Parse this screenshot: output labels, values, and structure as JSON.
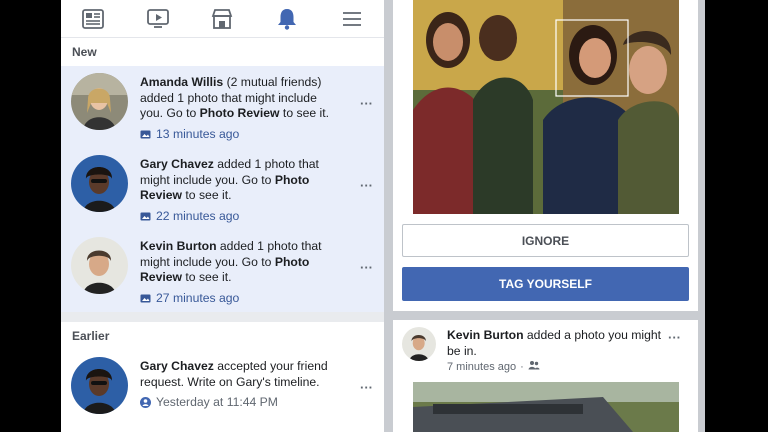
{
  "nav": {
    "icons": [
      "news-feed-icon",
      "watch-icon",
      "marketplace-icon",
      "notifications-icon",
      "menu-icon"
    ],
    "active_color": "#4267b2"
  },
  "sections": {
    "new_label": "New",
    "earlier_label": "Earlier"
  },
  "notifications": [
    {
      "name": "Amanda Willis",
      "text": " (2 mutual friends) added 1 photo that might include you. Go to ",
      "link": "Photo Review",
      "suffix": " to see it.",
      "time": "13 minutes ago"
    },
    {
      "name": "Gary Chavez",
      "text": " added 1 photo that might include you. Go to ",
      "link": "Photo Review",
      "suffix": " to see it.",
      "time": "22 minutes ago"
    },
    {
      "name": "Kevin Burton",
      "text": " added 1 photo that might include you. Go to ",
      "link": "Photo Review",
      "suffix": " to see it.",
      "time": "27 minutes ago"
    },
    {
      "name": "Gary Chavez",
      "text": " accepted your friend request. Write on Gary's timeline.",
      "time": "Yesterday at 11:44 PM"
    }
  ],
  "more_label": "···",
  "review": {
    "ignore_label": "IGNORE",
    "tag_label": "TAG YOURSELF"
  },
  "post": {
    "name": "Kevin Burton",
    "text": " added a photo you might be in.",
    "time": "7 minutes ago",
    "separator": "·",
    "more_label": "···"
  },
  "colors": {
    "brand": "#4267b2",
    "new_bg": "#e9eefa",
    "link": "#385898"
  }
}
